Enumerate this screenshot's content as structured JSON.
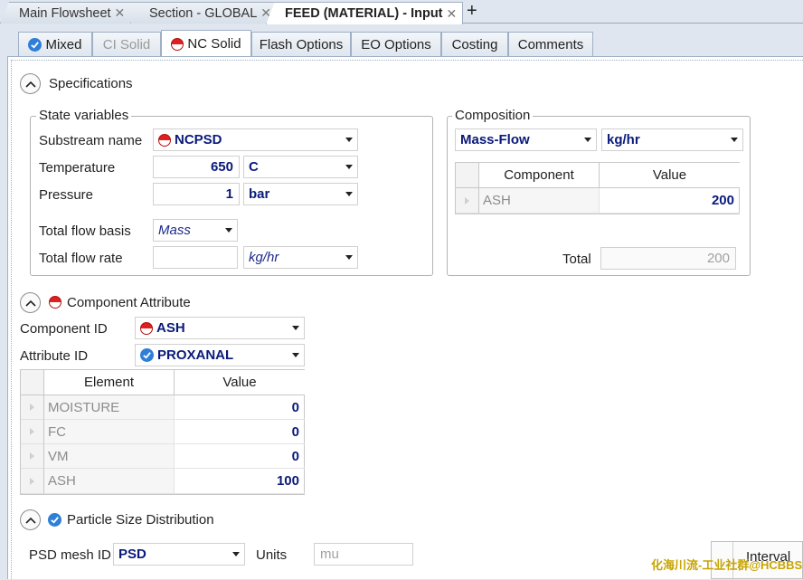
{
  "doc_tabs": [
    {
      "label": "Main Flowsheet"
    },
    {
      "label": "Section - GLOBAL"
    },
    {
      "label": "FEED (MATERIAL) - Input"
    }
  ],
  "form_tabs": [
    {
      "label": "Mixed",
      "icon": "check-icon"
    },
    {
      "label": "CI Solid"
    },
    {
      "label": "NC Solid",
      "icon": "red-status-icon"
    },
    {
      "label": "Flash Options"
    },
    {
      "label": "EO Options"
    },
    {
      "label": "Costing"
    },
    {
      "label": "Comments"
    }
  ],
  "specifications": {
    "title": "Specifications",
    "state_vars": {
      "legend": "State variables",
      "substream_label": "Substream name",
      "substream_value": "NCPSD",
      "temperature_label": "Temperature",
      "temperature_value": "650",
      "temperature_unit": "C",
      "pressure_label": "Pressure",
      "pressure_value": "1",
      "pressure_unit": "bar",
      "flow_basis_label": "Total flow basis",
      "flow_basis_value": "Mass",
      "flow_rate_label": "Total flow rate",
      "flow_rate_value": "",
      "flow_rate_unit": "kg/hr"
    },
    "composition": {
      "legend": "Composition",
      "basis": "Mass-Flow",
      "unit": "kg/hr",
      "headers": [
        "Component",
        "Value"
      ],
      "rows": [
        {
          "component": "ASH",
          "value": "200"
        }
      ],
      "total_label": "Total",
      "total_value": "200"
    }
  },
  "component_attribute": {
    "title": "Component Attribute",
    "component_id_label": "Component ID",
    "component_id_value": "ASH",
    "attribute_id_label": "Attribute ID",
    "attribute_id_value": "PROXANAL",
    "headers": [
      "Element",
      "Value"
    ],
    "rows": [
      {
        "element": "MOISTURE",
        "value": "0"
      },
      {
        "element": "FC",
        "value": "0"
      },
      {
        "element": "VM",
        "value": "0"
      },
      {
        "element": "ASH",
        "value": "100"
      }
    ]
  },
  "psd": {
    "title": "Particle Size Distribution",
    "mesh_label": "PSD mesh ID",
    "mesh_value": "PSD",
    "units_label": "Units",
    "units_value": "mu",
    "interval_label": "Interval"
  },
  "watermark": "化海川流-工业社群@HCBBS",
  "colors": {
    "accent": "#0a1a7a",
    "tab_bg": "#dfe6ef",
    "status_red": "#e02020",
    "status_blue": "#2f7fd8"
  }
}
